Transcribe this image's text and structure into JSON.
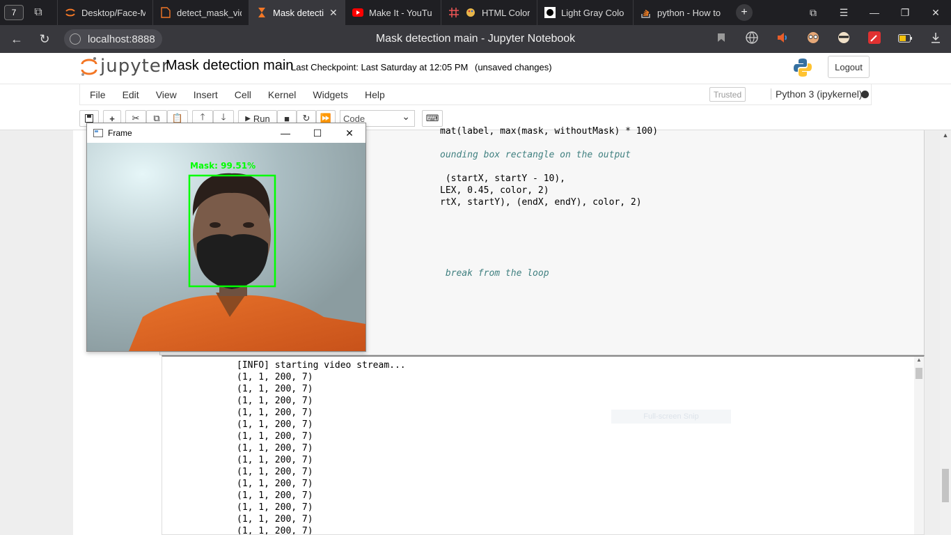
{
  "browser": {
    "workspace_count": "7",
    "tabs": [
      {
        "title": "Desktop/Face-M",
        "icon": "jupyter-spinner-icon",
        "active": false
      },
      {
        "title": "detect_mask_vid",
        "icon": "document-icon",
        "active": false
      },
      {
        "title": "Mask detecti",
        "icon": "hourglass-icon",
        "active": true
      },
      {
        "title": "Make It - YouTu",
        "icon": "youtube-icon",
        "active": false
      },
      {
        "title": "HTML Color",
        "icon": "palette-icon",
        "active": false
      },
      {
        "title": "Light Gray Colo",
        "icon": "color-swatch-icon",
        "active": false
      },
      {
        "title": "python - How to",
        "icon": "stackoverflow-icon",
        "active": false
      }
    ],
    "url": "localhost:8888",
    "page_title": "Mask detection main - Jupyter Notebook"
  },
  "jupyter": {
    "logo_text": "jupyter",
    "notebook_name": "Mask detection main",
    "checkpoint": "Last Checkpoint: Last Saturday at 12:05 PM",
    "unsaved": "(unsaved changes)",
    "logout_label": "Logout",
    "menu": [
      "File",
      "Edit",
      "View",
      "Insert",
      "Cell",
      "Kernel",
      "Widgets",
      "Help"
    ],
    "trusted_label": "Trusted",
    "kernel_name": "Python 3 (ipykernel)",
    "toolbar": {
      "run_label": "Run",
      "cell_type": "Code"
    }
  },
  "code_lines": [
    {
      "text": "mat(label, max(mask, withoutMask) * 100)"
    },
    {
      "text": "ounding box rectangle on the output"
    },
    {
      "text": " (startX, startY - 10),"
    },
    {
      "text": "LEX, 0.45, color, 2)"
    },
    {
      "text": "rtX, startY), (endX, endY), color, 2)"
    },
    {
      "text": " break from the loop"
    }
  ],
  "output": {
    "lines": [
      "[INFO] starting video stream...",
      "(1, 1, 200, 7)",
      "(1, 1, 200, 7)",
      "(1, 1, 200, 7)",
      "(1, 1, 200, 7)",
      "(1, 1, 200, 7)",
      "(1, 1, 200, 7)",
      "(1, 1, 200, 7)",
      "(1, 1, 200, 7)",
      "(1, 1, 200, 7)",
      "(1, 1, 200, 7)",
      "(1, 1, 200, 7)",
      "(1, 1, 200, 7)",
      "(1, 1, 200, 7)",
      "(1, 1, 200, 7)"
    ]
  },
  "snip_hint": "Full-screen Snip",
  "frame_window": {
    "title": "Frame",
    "detection_label": "Mask: 99.51%",
    "box_color": "#00ff00"
  }
}
